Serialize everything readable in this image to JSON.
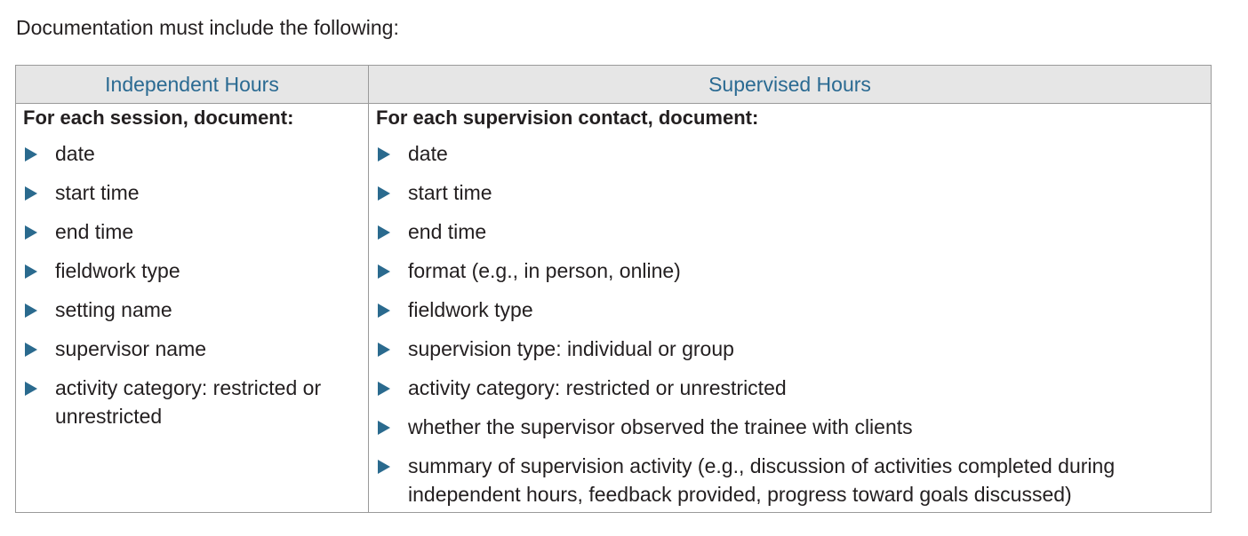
{
  "intro": "Documentation must include the following:",
  "accent_color": "#2a6a8e",
  "table": {
    "columns": [
      {
        "header": "Independent Hours",
        "subtitle": "For each session, document:",
        "items": [
          "date",
          "start time",
          "end time",
          "fieldwork type",
          "setting name",
          "supervisor name",
          "activity category: restricted or unrestricted"
        ]
      },
      {
        "header": "Supervised Hours",
        "subtitle": "For each supervision contact, document:",
        "items": [
          "date",
          "start time",
          "end time",
          "format (e.g., in person, online)",
          "fieldwork type",
          "supervision type: individual or group",
          "activity category: restricted or unrestricted",
          "whether the supervisor observed the trainee with clients",
          "summary of supervision activity (e.g., discussion of activities completed during independent hours, feedback provided, progress toward goals discussed)"
        ]
      }
    ]
  }
}
